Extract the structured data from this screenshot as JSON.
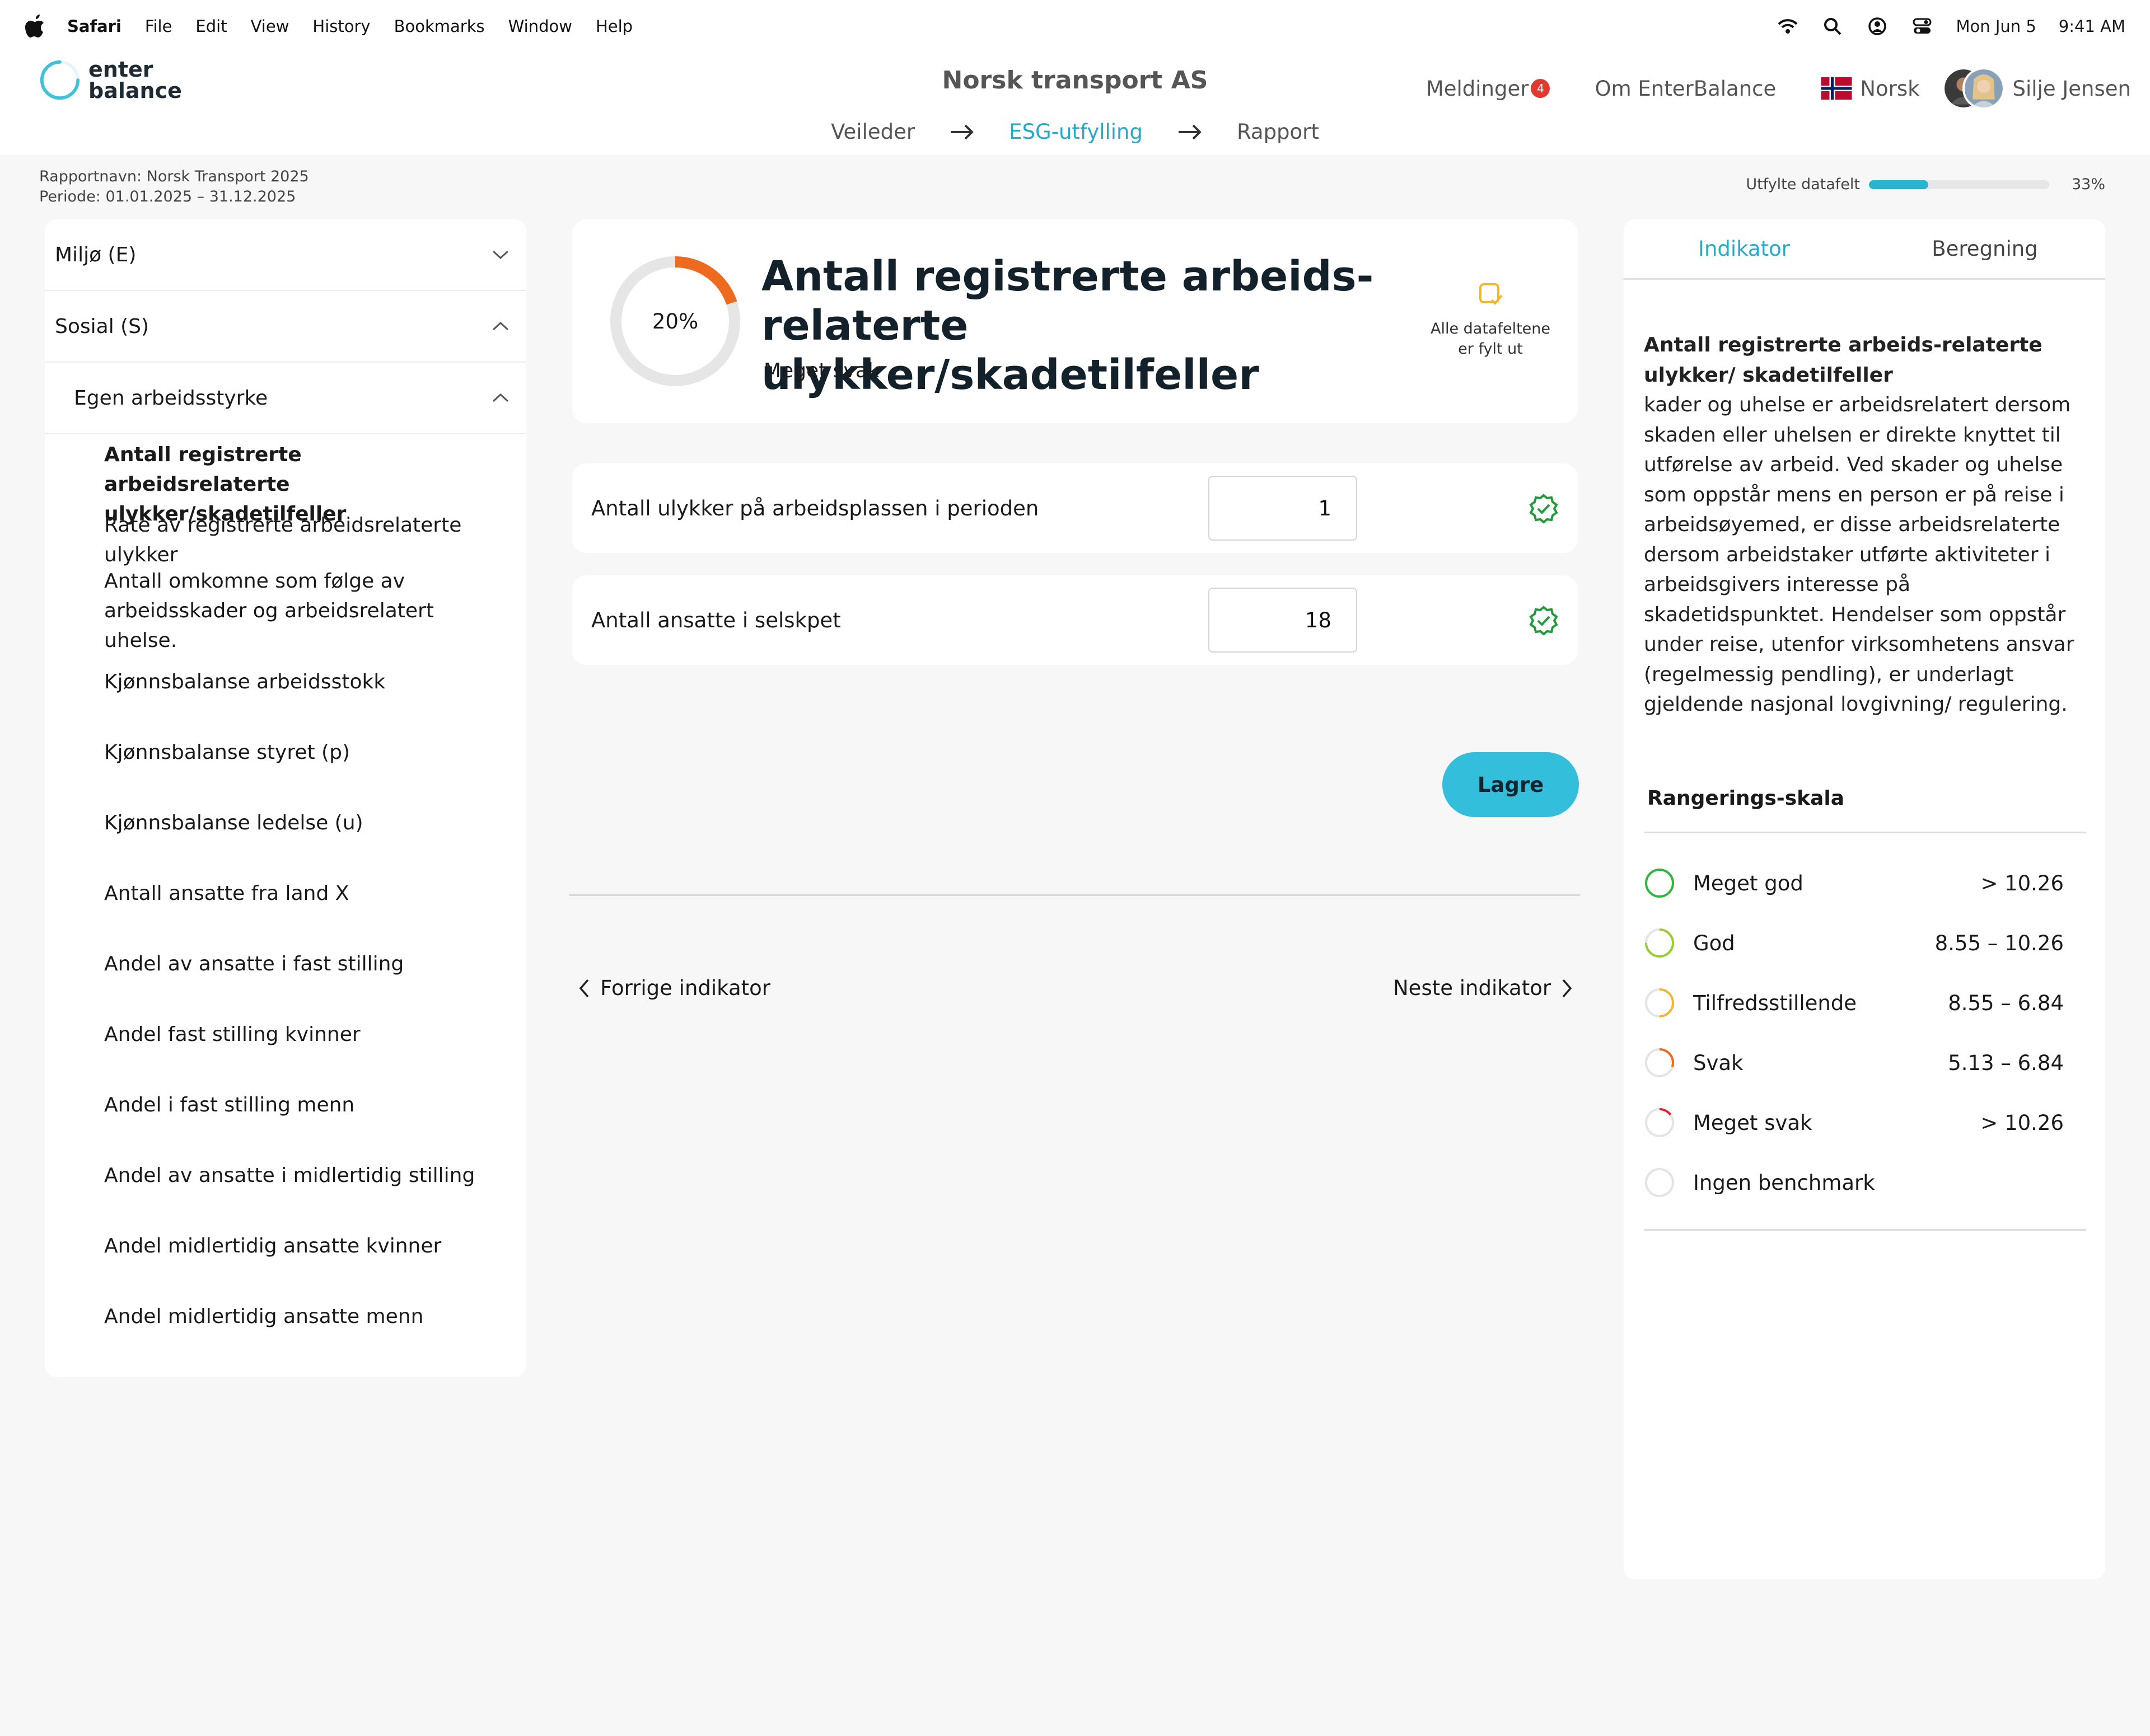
{
  "menubar": {
    "app": "Safari",
    "items": [
      "File",
      "Edit",
      "View",
      "History",
      "Bookmarks",
      "Window",
      "Help"
    ],
    "date": "Mon Jun 5",
    "time": "9:41 AM"
  },
  "header": {
    "logo_line1": "enter",
    "logo_line2": "balance",
    "company": "Norsk transport AS",
    "messages_label": "Meldinger",
    "messages_count": "4",
    "about": "Om EnterBalance",
    "language": "Norsk",
    "user": "Silje Jensen"
  },
  "steps": [
    "Veileder",
    "ESG-utfylling",
    "Rapport"
  ],
  "report": {
    "name": "Rapportnavn: Norsk Transport 2025",
    "period": "Periode: 01.01.2025 – 31.12.2025",
    "progress_label": "Utfylte datafelt",
    "progress_value": "33%",
    "progress_fraction": 0.33
  },
  "sidebar": {
    "env": "Miljø (E)",
    "social": "Sosial (S)",
    "group": "Egen arbeidsstyrke",
    "items": [
      "Antall registrerte arbeidsrelaterte ulykker/skadetilfeller",
      "Rate av registrerte arbeidsrelaterte ulykker",
      "Antall omkomne som følge av arbeidsskader og arbeidsrelatert uhelse.",
      "Kjønnsbalanse arbeidsstokk",
      "Kjønnsbalanse styret (p)",
      "Kjønnsbalanse ledelse (u)",
      "Antall ansatte fra land X",
      "Andel av ansatte i fast stilling",
      "Andel fast stilling kvinner",
      "Andel i fast stilling menn",
      "Andel av ansatte i midlertidig stilling",
      "Andel midlertidig ansatte kvinner",
      "Andel midlertidig ansatte menn"
    ]
  },
  "indicator": {
    "percent_label": "20%",
    "percent_fraction": 0.2,
    "title_line1": "Antall registrerte arbeids-",
    "title_line2": "relaterte ulykker/skadetilfeller",
    "rating": "Meget svak",
    "status_line1": "Alle datafeltene",
    "status_line2": "er fylt ut"
  },
  "fields": [
    {
      "label": "Antall ulykker på arbeidsplassen i perioden",
      "value": "1"
    },
    {
      "label": "Antall ansatte i selskpet",
      "value": "18"
    }
  ],
  "actions": {
    "save": "Lagre",
    "prev": "Forrige indikator",
    "next": "Neste indikator"
  },
  "panel": {
    "tab1": "Indikator",
    "tab2": "Beregning",
    "heading": "Antall registrerte arbeids-relaterte ulykker/ skadetilfeller",
    "body": "kader og uhelse er arbeidsrelatert dersom skaden eller uhelsen er direkte knyttet til utførelse av arbeid. Ved skader og uhelse som oppstår mens en person er på reise i arbeidsøyemed, er disse arbeidsrelaterte dersom arbeidstaker utførte aktiviteter i arbeidsgivers interesse på skadetidspunktet. Hendelser som oppstår under reise, utenfor virksomhetens ansvar (regelmessig pendling), er underlagt gjeldende nasjonal lovgivning/ regulering.",
    "scale_title": "Rangerings-skala",
    "scale": [
      {
        "label": "Meget god",
        "value": "> 10.26",
        "color": "#2db83d",
        "fraction": 1.0
      },
      {
        "label": "God",
        "value": "8.55 – 10.26",
        "color": "#9acd32",
        "fraction": 0.75
      },
      {
        "label": "Tilfredsstillende",
        "value": "8.55 – 6.84",
        "color": "#f2b632",
        "fraction": 0.5
      },
      {
        "label": "Svak",
        "value": "5.13 – 6.84",
        "color": "#ee6a1f",
        "fraction": 0.3
      },
      {
        "label": "Meget svak",
        "value": "> 10.26",
        "color": "#d6262b",
        "fraction": 0.15
      },
      {
        "label": "Ingen benchmark",
        "value": "",
        "color": "#cccccc",
        "fraction": 0
      }
    ]
  },
  "colors": {
    "accent": "#27aac7",
    "save_button": "#33bedb",
    "ring_progress": "#ee6a1f",
    "check_green": "#1e9a3a",
    "status_icon": "#f2b632"
  }
}
